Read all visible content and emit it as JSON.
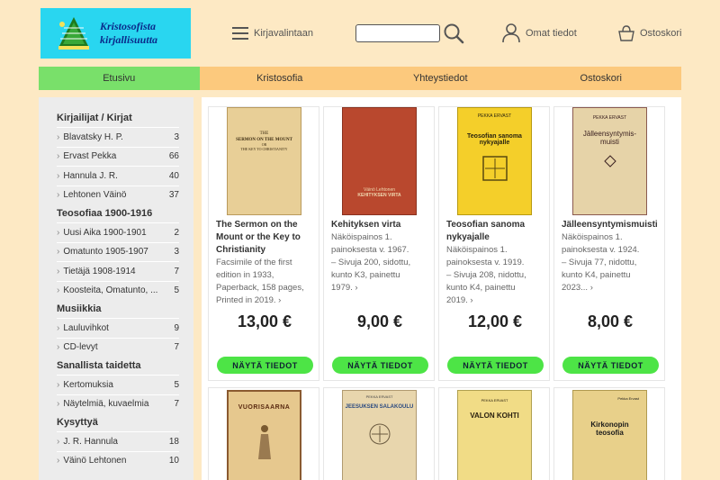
{
  "header": {
    "logo_lines": [
      "Kristosofista",
      "kirjallisuutta"
    ],
    "menu_label": "Kirjavalintaan",
    "search_placeholder": "",
    "account_label": "Omat tiedot",
    "cart_label": "Ostoskori"
  },
  "nav": [
    "Etusivu",
    "Kristosofia",
    "Yhteystiedot",
    "Ostoskori"
  ],
  "sidebar": {
    "sections": [
      {
        "heading": "Kirjailijat / Kirjat",
        "items": [
          {
            "label": "Blavatsky H. P.",
            "count": "3"
          },
          {
            "label": "Ervast Pekka",
            "count": "66"
          },
          {
            "label": "Hannula J. R.",
            "count": "40"
          },
          {
            "label": "Lehtonen Väinö",
            "count": "37"
          }
        ]
      },
      {
        "heading": "Teosofiaa 1900-1916",
        "items": [
          {
            "label": "Uusi Aika 1900-1901",
            "count": "2"
          },
          {
            "label": "Omatunto 1905-1907",
            "count": "3"
          },
          {
            "label": "Tietäjä 1908-1914",
            "count": "7"
          },
          {
            "label": "Koosteita, Omatunto, ...",
            "count": "5"
          }
        ]
      },
      {
        "heading": "Musiikkia",
        "items": [
          {
            "label": "Lauluvihkot",
            "count": "9"
          },
          {
            "label": "CD-levyt",
            "count": "7"
          }
        ]
      },
      {
        "heading": "Sanallista taidetta",
        "items": [
          {
            "label": "Kertomuksia",
            "count": "5"
          },
          {
            "label": "Näytelmiä, kuvaelmia",
            "count": "7"
          }
        ]
      },
      {
        "heading": "Kysyttyä",
        "items": [
          {
            "label": "J. R. Hannula",
            "count": "18"
          },
          {
            "label": "Väinö Lehtonen",
            "count": "10"
          }
        ]
      }
    ]
  },
  "products": [
    {
      "title_lines": [
        "The Sermon on the",
        "Mount or the Key to",
        "Christianity"
      ],
      "desc_lines": [
        "Facsimile of the first",
        "edition in 1933,",
        "Paperback, 158 pages,",
        "Printed in 2019. ›"
      ],
      "price": "13,00 €",
      "button": "NÄYTÄ TIEDOT",
      "cover_bg": "#e8cf97",
      "cover_text": [
        "THE",
        "SERMON ON THE MOUNT",
        "OR",
        "THE KEY TO CHRISTIANITY"
      ]
    },
    {
      "title_lines": [
        "Kehityksen virta"
      ],
      "desc_lines": [
        "Näköispainos 1.",
        "painoksesta v. 1967.",
        "– Sivuja 200, sidottu,",
        "kunto K3, painettu",
        "1979. ›"
      ],
      "price": "9,00 €",
      "button": "NÄYTÄ TIEDOT",
      "cover_bg": "#b9482e",
      "cover_text": [
        "Väinö Lehtonen",
        "KEHITYKSEN VIRTA"
      ]
    },
    {
      "title_lines": [
        "Teosofian sanoma",
        "nykyajalle"
      ],
      "desc_lines": [
        "Näköispainos 1.",
        "painoksesta v. 1919.",
        "– Sivuja 208, nidottu,",
        "kunto K4, painettu",
        "2019. ›"
      ],
      "price": "12,00 €",
      "button": "NÄYTÄ TIEDOT",
      "cover_bg": "#f4cf2a",
      "cover_text": [
        "PEKKA ERVAST",
        "Teosofian sanoma",
        "nykyajalle"
      ]
    },
    {
      "title_lines": [
        "Jälleensyntymismuisti"
      ],
      "desc_lines": [
        "Näköispainos 1.",
        "painoksesta v. 1924.",
        "– Sivuja 77, nidottu,",
        "kunto K4, painettu",
        "2023... ›"
      ],
      "price": "8,00 €",
      "button": "NÄYTÄ TIEDOT",
      "cover_bg": "#e6d3a8",
      "cover_text": [
        "PEKKA ERVAST",
        "Jälleensyntymis-",
        "muisti"
      ]
    },
    {
      "cover_bg": "#e6c88e",
      "cover_text": [
        "VUORISAARNA"
      ]
    },
    {
      "cover_bg": "#e8d6ad",
      "cover_text": [
        "PEKKA ERVAST",
        "JEESUKSEN SALAKOULU"
      ]
    },
    {
      "cover_bg": "#f1dc86",
      "cover_text": [
        "PEKKA ERVAST",
        "VALON KOHTI"
      ]
    },
    {
      "cover_bg": "#e8d08a",
      "cover_text": [
        "Pekka Ervast",
        "Kirkonopin",
        "teosofia"
      ]
    }
  ]
}
